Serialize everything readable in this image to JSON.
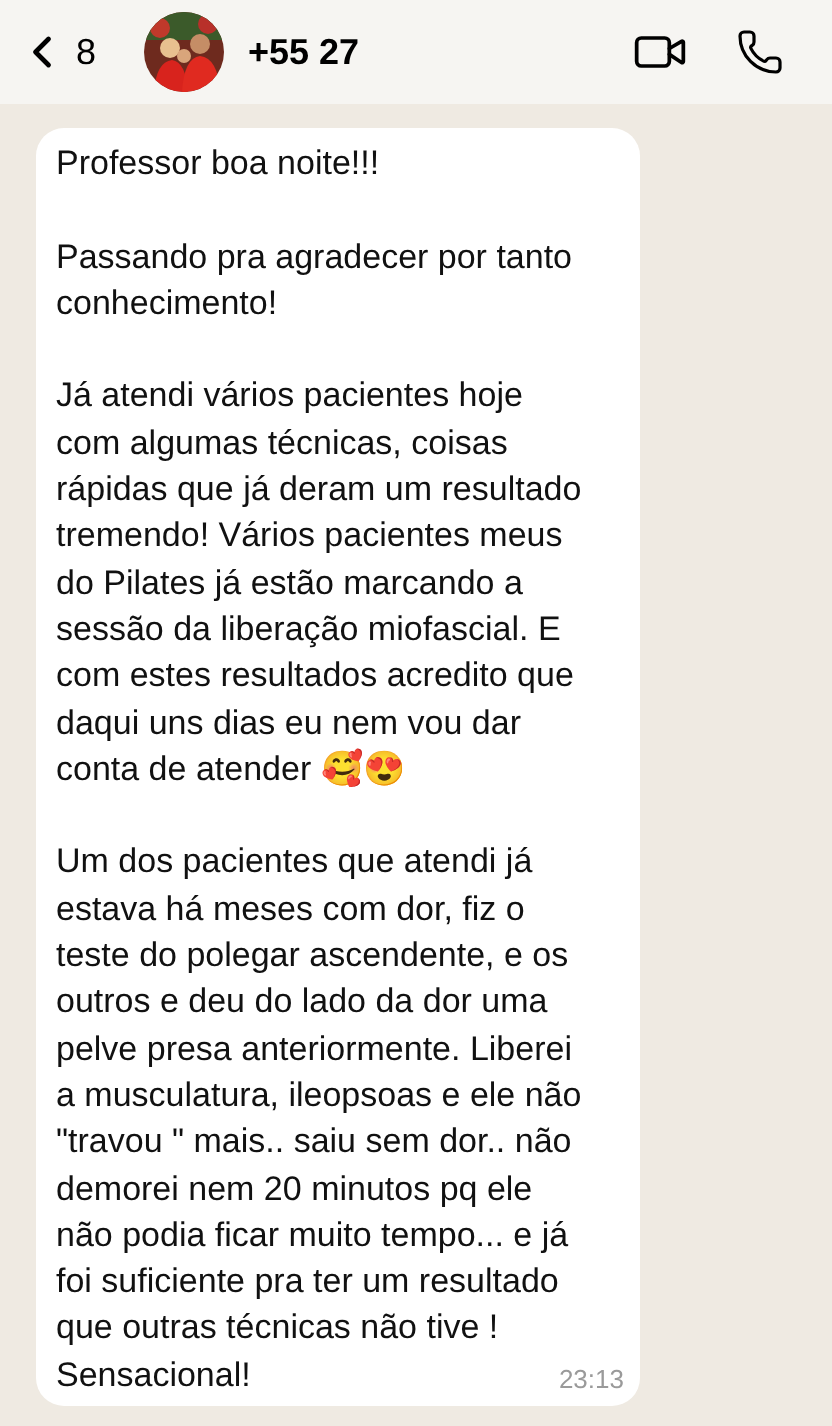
{
  "header": {
    "back_count": "8",
    "contact": "+55 27"
  },
  "message": {
    "paragraphs": [
      "Professor boa noite!!!",
      "Passando pra agradecer por tanto\nconhecimento!",
      "Já atendi vários pacientes hoje\ncom algumas técnicas, coisas\nrápidas que já deram um resultado\ntremendo!  Vários pacientes meus\ndo Pilates já estão marcando a\nsessão da liberação miofascial. E\ncom estes resultados acredito que\ndaqui uns dias eu nem vou dar\nconta de atender 🥰😍",
      "Um dos pacientes que atendi já\nestava há meses com dor, fiz o\nteste do polegar ascendente, e os\noutros e deu do lado da dor uma\npelve presa anteriormente. Liberei\na musculatura, ileopsoas e ele não\n\"travou \" mais.. saiu sem dor.. não\ndemorei nem 20 minutos pq ele\nnão podia ficar muito tempo... e já\nfoi suficiente pra ter um resultado\nque outras técnicas não tive !\nSensacional!"
    ],
    "time": "23:13"
  }
}
